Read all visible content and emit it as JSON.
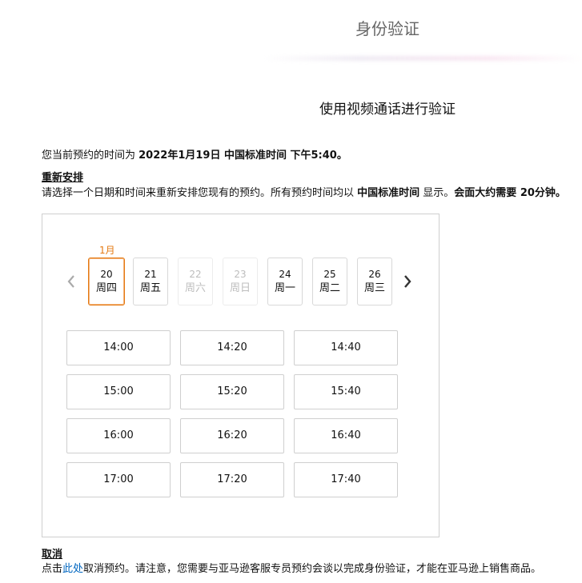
{
  "header": {
    "title": "身份验证"
  },
  "page_heading": "使用视频通话进行验证",
  "current": {
    "prefix": "您当前预约的时间为 ",
    "datetime": "2022年1月19日 中国标准时间 下午5:40。"
  },
  "reschedule": {
    "title": "重新安排",
    "desc_prefix": "请选择一个日期和时间来重新安排您现有的预约。所有预约时间均以 ",
    "tz": "中国标准时间",
    "desc_mid": " 显示。",
    "duration": "会面大约需要 20分钟。"
  },
  "calendar": {
    "month": "1月",
    "days": [
      {
        "date": "20",
        "weekday": "周四",
        "state": "selected"
      },
      {
        "date": "21",
        "weekday": "周五",
        "state": "available"
      },
      {
        "date": "22",
        "weekday": "周六",
        "state": "disabled"
      },
      {
        "date": "23",
        "weekday": "周日",
        "state": "disabled"
      },
      {
        "date": "24",
        "weekday": "周一",
        "state": "available"
      },
      {
        "date": "25",
        "weekday": "周二",
        "state": "available"
      },
      {
        "date": "26",
        "weekday": "周三",
        "state": "available"
      }
    ],
    "slots": [
      "14:00",
      "14:20",
      "14:40",
      "15:00",
      "15:20",
      "15:40",
      "16:00",
      "16:20",
      "16:40",
      "17:00",
      "17:20",
      "17:40"
    ]
  },
  "cancel": {
    "title": "取消",
    "prefix": "点击",
    "link": "此处",
    "suffix": "取消预约。请注意，您需要与亚马逊客服专员预约会谈以完成身份验证，才能在亚马逊上销售商品。"
  },
  "colors": {
    "accent": "#e47911",
    "link": "#0066c0"
  },
  "icons": {
    "prev": "chevron-left-icon",
    "next": "chevron-right-icon"
  }
}
